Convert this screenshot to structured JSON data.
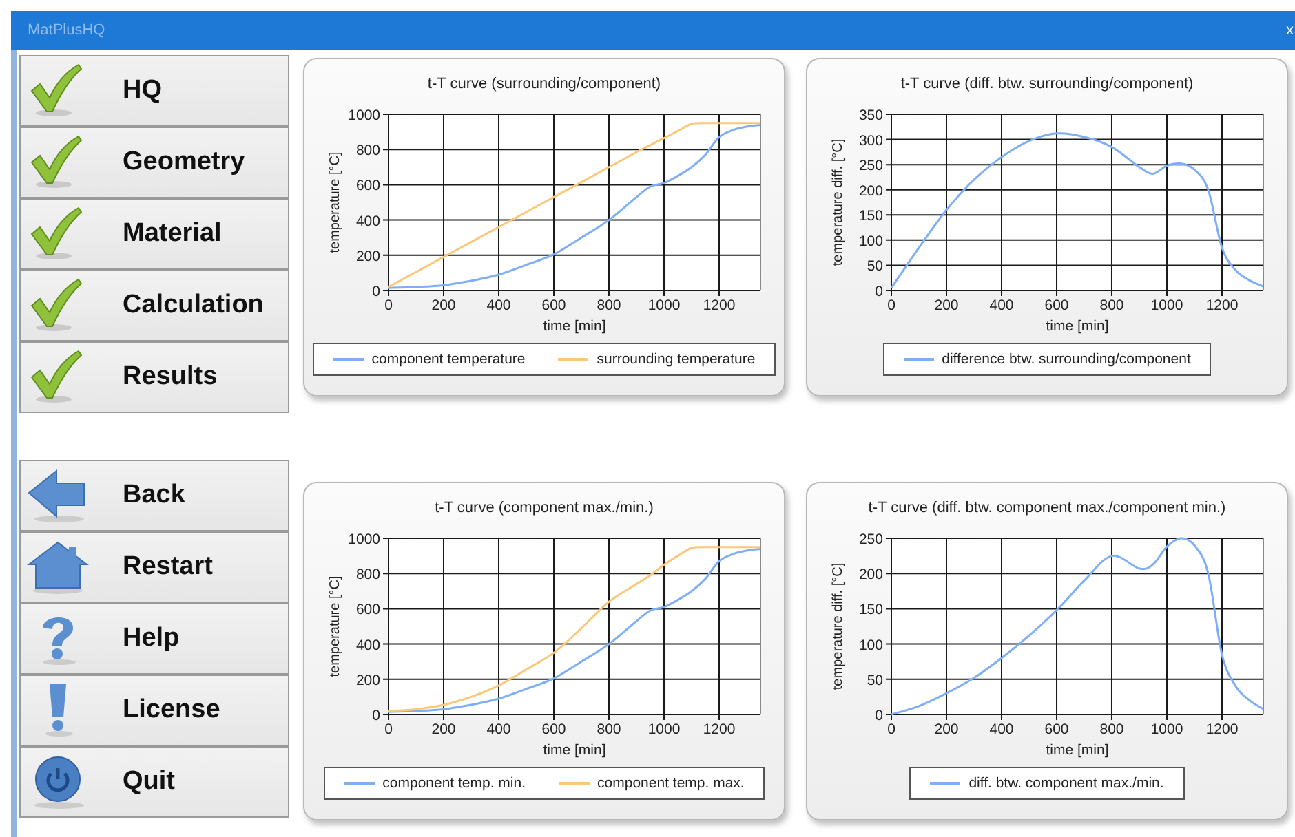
{
  "window": {
    "title": "MatPlusHQ",
    "close": "x"
  },
  "steps": [
    {
      "label": "HQ",
      "checked": true
    },
    {
      "label": "Geometry",
      "checked": true
    },
    {
      "label": "Material",
      "checked": true
    },
    {
      "label": "Calculation",
      "checked": true
    },
    {
      "label": "Results",
      "checked": true
    }
  ],
  "actions": [
    {
      "label": "Back"
    },
    {
      "label": "Restart"
    },
    {
      "label": "Help"
    },
    {
      "label": "License"
    },
    {
      "label": "Quit"
    }
  ],
  "charts": [
    {
      "chart_data": {
        "type": "line",
        "grid": true,
        "title": "t-T curve (surrounding/component)",
        "xlabel": "time [min]",
        "ylabel": "temperature [°C]",
        "x": [
          0,
          100,
          200,
          300,
          400,
          500,
          600,
          700,
          800,
          900,
          950,
          1000,
          1050,
          1100,
          1150,
          1200,
          1250,
          1300,
          1350
        ],
        "xlim": [
          0,
          1350
        ],
        "ylim": [
          0,
          1000
        ],
        "xticks": [
          0,
          200,
          400,
          600,
          800,
          1000,
          1200
        ],
        "yticks": [
          0,
          200,
          400,
          600,
          800,
          1000
        ],
        "series": [
          {
            "name": "component temperature",
            "color": "#7eaef5",
            "values": [
              15,
              20,
              30,
              55,
              90,
              145,
              205,
              300,
              400,
              530,
              590,
              610,
              650,
              700,
              770,
              870,
              910,
              930,
              940
            ]
          },
          {
            "name": "surrounding temperature",
            "color": "#fbc77a",
            "values": [
              20,
              105,
              190,
              275,
              360,
              445,
              530,
              615,
              700,
              785,
              825,
              865,
              905,
              945,
              950,
              950,
              950,
              950,
              950
            ]
          }
        ]
      }
    },
    {
      "chart_data": {
        "type": "line",
        "grid": true,
        "title": "t-T curve (diff. btw. surrounding/component)",
        "xlabel": "time [min]",
        "ylabel": "temperature diff. [°C]",
        "x": [
          0,
          100,
          200,
          300,
          400,
          500,
          600,
          700,
          800,
          900,
          950,
          1000,
          1050,
          1100,
          1150,
          1200,
          1250,
          1300,
          1350
        ],
        "xlim": [
          0,
          1350
        ],
        "ylim": [
          0,
          350
        ],
        "xticks": [
          0,
          200,
          400,
          600,
          800,
          1000,
          1200
        ],
        "yticks": [
          0,
          50,
          100,
          150,
          200,
          250,
          300,
          350
        ],
        "series": [
          {
            "name": "difference btw. surrounding/component",
            "color": "#7eaef5",
            "values": [
              5,
              85,
              160,
              220,
              265,
              297,
              312,
              305,
              285,
              245,
              232,
              248,
              252,
              240,
              200,
              85,
              40,
              20,
              8
            ]
          }
        ]
      }
    },
    {
      "chart_data": {
        "type": "line",
        "grid": true,
        "title": "t-T curve (component max./min.)",
        "xlabel": "time [min]",
        "ylabel": "temperature [°C]",
        "x": [
          0,
          100,
          200,
          300,
          400,
          500,
          600,
          700,
          800,
          900,
          950,
          1000,
          1050,
          1100,
          1150,
          1200,
          1250,
          1300,
          1350
        ],
        "xlim": [
          0,
          1350
        ],
        "ylim": [
          0,
          1000
        ],
        "xticks": [
          0,
          200,
          400,
          600,
          800,
          1000,
          1200
        ],
        "yticks": [
          0,
          200,
          400,
          600,
          800,
          1000
        ],
        "series": [
          {
            "name": "component temp. min.",
            "color": "#7eaef5",
            "values": [
              15,
              20,
              30,
              55,
              90,
              145,
              205,
              300,
              400,
              530,
              590,
              610,
              650,
              700,
              770,
              870,
              910,
              930,
              940
            ]
          },
          {
            "name": "component temp. max.",
            "color": "#fbc77a",
            "values": [
              20,
              30,
              55,
              100,
              165,
              255,
              350,
              490,
              640,
              740,
              790,
              850,
              900,
              945,
              950,
              950,
              950,
              950,
              950
            ]
          }
        ]
      }
    },
    {
      "chart_data": {
        "type": "line",
        "grid": true,
        "title": "t-T curve (diff. btw. component max./component min.)",
        "xlabel": "time [min]",
        "ylabel": "temperature diff. [°C]",
        "x": [
          0,
          100,
          200,
          300,
          400,
          500,
          600,
          700,
          800,
          900,
          950,
          1000,
          1050,
          1100,
          1150,
          1200,
          1250,
          1300,
          1350
        ],
        "xlim": [
          0,
          1350
        ],
        "ylim": [
          0,
          250
        ],
        "xticks": [
          0,
          200,
          400,
          600,
          800,
          1000,
          1200
        ],
        "yticks": [
          0,
          50,
          100,
          150,
          200,
          250
        ],
        "series": [
          {
            "name": "diff. btw. component max./min.",
            "color": "#7eaef5",
            "values": [
              0,
              12,
              30,
              52,
              80,
              112,
              148,
              190,
              225,
              207,
              213,
              238,
              250,
              240,
              200,
              85,
              40,
              20,
              8
            ]
          }
        ]
      }
    }
  ]
}
